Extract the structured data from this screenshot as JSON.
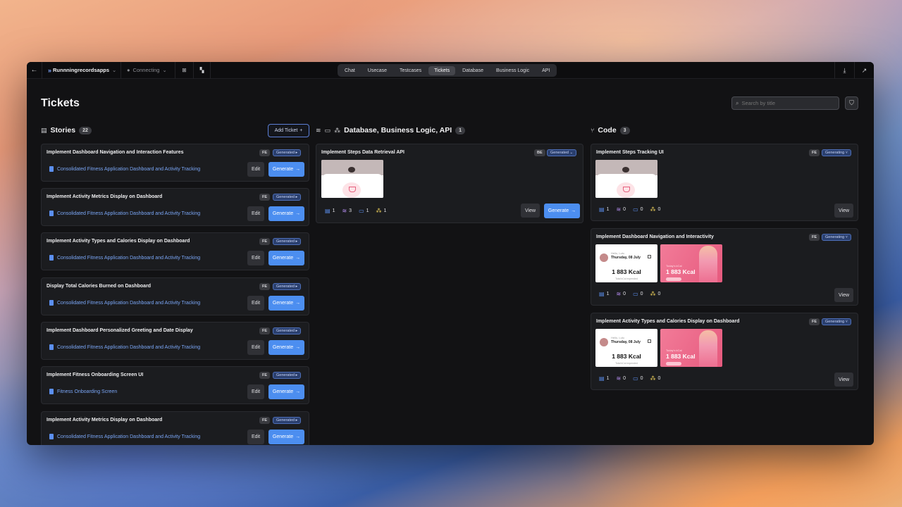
{
  "app": {
    "name": "Runnningrecordsapps",
    "github_status": "Connecting"
  },
  "tabs": [
    "Chat",
    "Usecase",
    "Testcases",
    "Tickets",
    "Database",
    "Business Logic",
    "API"
  ],
  "active_tab": "Tickets",
  "page": {
    "title": "Tickets",
    "search_placeholder": "Search by title"
  },
  "stories": {
    "title": "Stories",
    "count": "22",
    "add_label": "Add Ticket",
    "edit_label": "Edit",
    "generate_label": "Generate",
    "items": [
      {
        "title": "Implement Dashboard Navigation and Interaction Features",
        "tag": "FE",
        "status": "Generated",
        "link": "Consolidated Fitness Application Dashboard and Activity Tracking"
      },
      {
        "title": "Implement Activity Metrics Display on Dashboard",
        "tag": "FE",
        "status": "Generated",
        "link": "Consolidated Fitness Application Dashboard and Activity Tracking"
      },
      {
        "title": "Implement Activity Types and Calories Display on Dashboard",
        "tag": "FE",
        "status": "Generated",
        "link": "Consolidated Fitness Application Dashboard and Activity Tracking"
      },
      {
        "title": "Display Total Calories Burned on Dashboard",
        "tag": "FE",
        "status": "Generated",
        "link": "Consolidated Fitness Application Dashboard and Activity Tracking"
      },
      {
        "title": "Implement Dashboard Personalized Greeting and Date Display",
        "tag": "FE",
        "status": "Generated",
        "link": "Consolidated Fitness Application Dashboard and Activity Tracking"
      },
      {
        "title": "Implement Fitness Onboarding Screen UI",
        "tag": "FE",
        "status": "Generated",
        "link": "Fitness Onboarding Screen"
      },
      {
        "title": "Implement Activity Metrics Display on Dashboard",
        "tag": "FE",
        "status": "Generated",
        "link": "Consolidated Fitness Application Dashboard and Activity Tracking"
      }
    ]
  },
  "backend": {
    "title": "Database, Business Logic, API",
    "count": "1",
    "card": {
      "title": "Implement Steps Data Retrieval API",
      "tag": "BE",
      "status": "Generated",
      "stats": [
        "1",
        "3",
        "1",
        "1"
      ],
      "view_label": "View",
      "generate_label": "Generate"
    }
  },
  "code": {
    "title": "Code",
    "count": "3",
    "view_label": "View",
    "cards": [
      {
        "title": "Implement Steps Tracking UI",
        "tag": "FE",
        "status": "Generating",
        "stats": [
          "1",
          "0",
          "0",
          "0"
        ]
      },
      {
        "title": "Implement Dashboard Navigation and Interactivity",
        "tag": "FE",
        "status": "Generating",
        "stats": [
          "1",
          "0",
          "0",
          "0"
        ]
      },
      {
        "title": "Implement Activity Types and Calories Display on Dashboard",
        "tag": "FE",
        "status": "Generating",
        "stats": [
          "1",
          "0",
          "0",
          "0"
        ]
      }
    ]
  },
  "preview": {
    "hello": "Hello, Lulu",
    "date": "Thursday, 08 July",
    "kcal": "1 883 Kcal",
    "sub": "Total kCal expended",
    "pink_label": "Today's kCal"
  }
}
